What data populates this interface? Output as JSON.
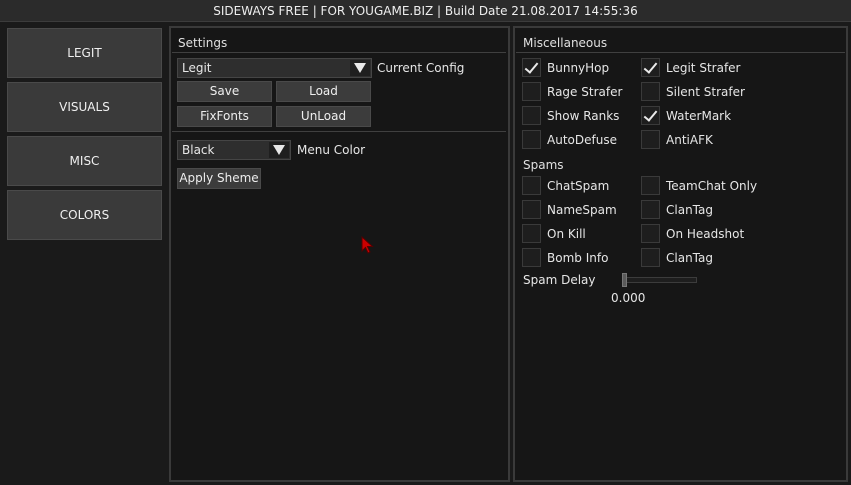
{
  "window": {
    "title": "SIDEWAYS FREE | FOR YOUGAME.BIZ | Build Date 21.08.2017 14:55:36"
  },
  "nav": {
    "items": [
      {
        "label": "LEGIT"
      },
      {
        "label": "VISUALS"
      },
      {
        "label": "MISC"
      },
      {
        "label": "COLORS"
      }
    ]
  },
  "settings": {
    "title": "Settings",
    "config_select": {
      "value": "Legit",
      "label": "Current Config"
    },
    "buttons": {
      "save": "Save",
      "load": "Load",
      "fixfonts": "FixFonts",
      "unload": "UnLoad"
    },
    "menu_color": {
      "value": "Black",
      "label": "Menu Color"
    },
    "apply_label": "Apply Sheme"
  },
  "misc": {
    "title": "Miscellaneous",
    "options": [
      {
        "label": "BunnyHop",
        "checked": true
      },
      {
        "label": "Legit Strafer",
        "checked": true
      },
      {
        "label": "Rage Strafer",
        "checked": false
      },
      {
        "label": "Silent Strafer",
        "checked": false
      },
      {
        "label": "Show Ranks",
        "checked": false
      },
      {
        "label": "WaterMark",
        "checked": true
      },
      {
        "label": "AutoDefuse",
        "checked": false
      },
      {
        "label": "AntiAFK",
        "checked": false
      }
    ],
    "spams_title": "Spams",
    "spams": [
      {
        "label": "ChatSpam",
        "checked": false
      },
      {
        "label": "TeamChat Only",
        "checked": false
      },
      {
        "label": "NameSpam",
        "checked": false
      },
      {
        "label": "ClanTag",
        "checked": false
      },
      {
        "label": "On Kill",
        "checked": false
      },
      {
        "label": "On Headshot",
        "checked": false
      },
      {
        "label": "Bomb Info",
        "checked": false
      },
      {
        "label": "ClanTag",
        "checked": false
      }
    ],
    "spam_delay": {
      "label": "Spam Delay",
      "value": "0.000",
      "fraction": 0.0
    }
  },
  "colors": {
    "cursor": "#cc0000"
  }
}
